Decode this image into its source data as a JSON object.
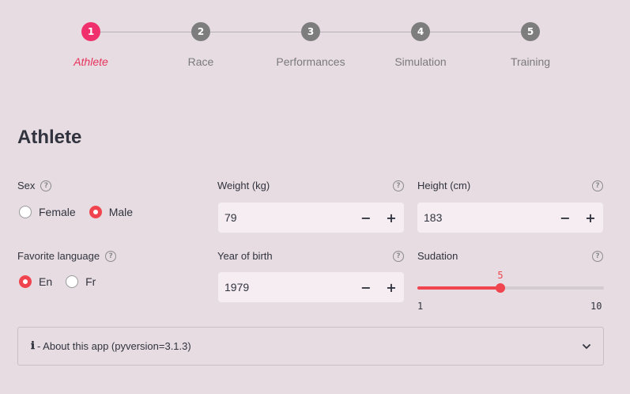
{
  "stepper": {
    "steps": [
      {
        "number": "1",
        "label": "Athlete",
        "active": true
      },
      {
        "number": "2",
        "label": "Race",
        "active": false
      },
      {
        "number": "3",
        "label": "Performances",
        "active": false
      },
      {
        "number": "4",
        "label": "Simulation",
        "active": false
      },
      {
        "number": "5",
        "label": "Training",
        "active": false
      }
    ]
  },
  "page": {
    "title": "Athlete"
  },
  "sex": {
    "label": "Sex",
    "options": [
      "Female",
      "Male"
    ],
    "selected": "Male"
  },
  "weight": {
    "label": "Weight (kg)",
    "value": "79"
  },
  "height": {
    "label": "Height (cm)",
    "value": "183"
  },
  "language": {
    "label": "Favorite language",
    "options": [
      "En",
      "Fr"
    ],
    "selected": "En"
  },
  "birth": {
    "label": "Year of birth",
    "value": "1979"
  },
  "sudation": {
    "label": "Sudation",
    "value": "5",
    "min": "1",
    "max": "10"
  },
  "controls": {
    "minus": "−",
    "plus": "+",
    "help": "?"
  },
  "expander": {
    "icon": "ℹ",
    "label": "- About this app (pyversion=3.1.3)"
  },
  "colors": {
    "accent": "#f0444f",
    "step_active": "#f0306d",
    "background": "#e6dce1"
  }
}
